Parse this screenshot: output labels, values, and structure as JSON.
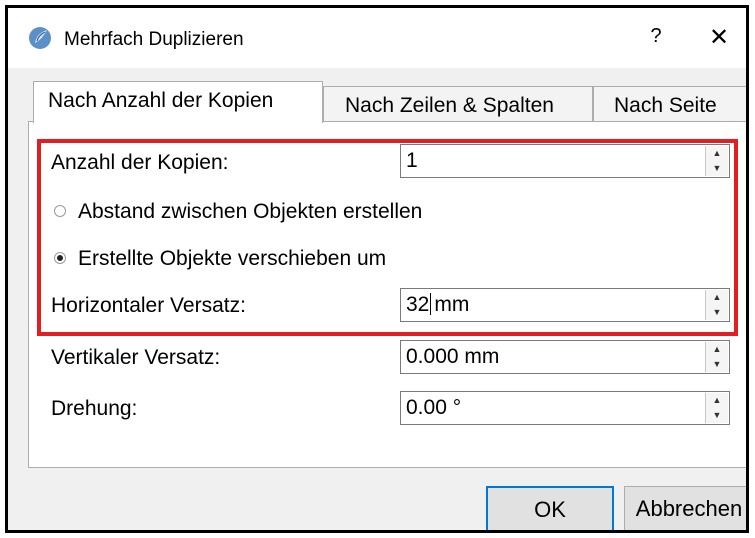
{
  "window": {
    "title": "Mehrfach Duplizieren",
    "help_label": "?",
    "close_label": "✕"
  },
  "tabs": [
    {
      "label": "Nach Anzahl der Kopien",
      "active": true
    },
    {
      "label": "Nach Zeilen & Spalten",
      "active": false
    },
    {
      "label": "Nach Seite",
      "active": false
    }
  ],
  "form": {
    "copies": {
      "label": "Anzahl der Kopien:",
      "value": "1"
    },
    "radio_spacing": {
      "label": "Abstand zwischen Objekten erstellen",
      "checked": false
    },
    "radio_shift": {
      "label": "Erstellte Objekte verschieben um",
      "checked": true
    },
    "horizontal": {
      "label": "Horizontaler Versatz:",
      "value_before_cursor": "32",
      "value_after_cursor": "mm"
    },
    "vertical": {
      "label": "Vertikaler Versatz:",
      "value": "0.000 mm"
    },
    "rotation": {
      "label": "Drehung:",
      "value": "0.00 °"
    }
  },
  "buttons": {
    "ok": "OK",
    "cancel": "Abbrechen"
  },
  "colors": {
    "highlight": "#e41e20",
    "ok_border": "#0078d7"
  }
}
